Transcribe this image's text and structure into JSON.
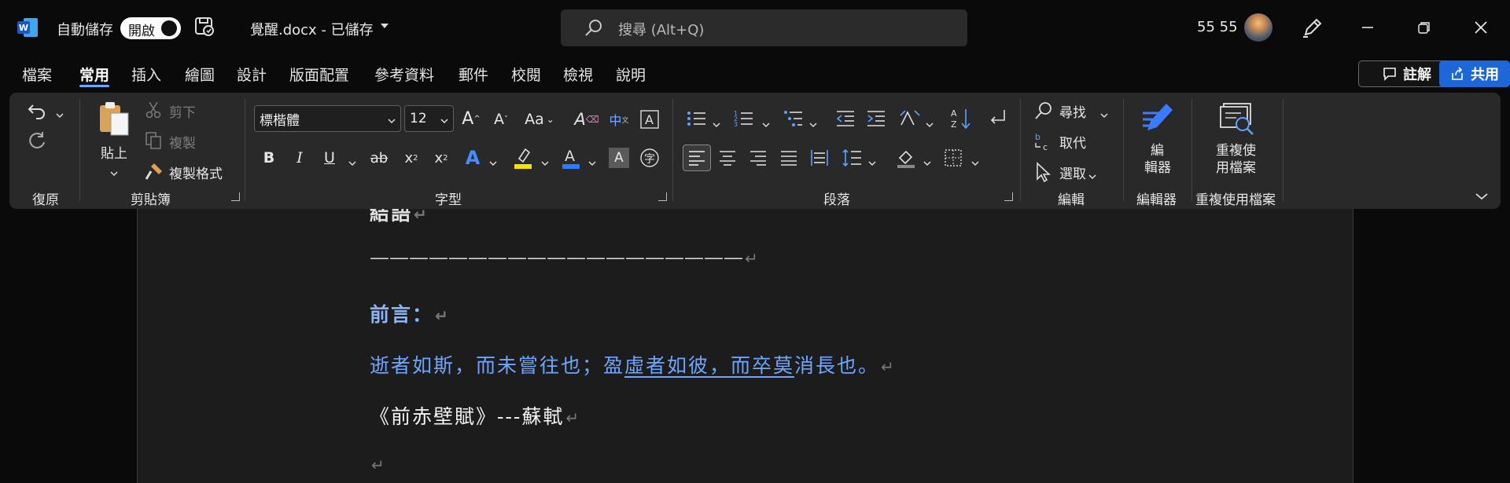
{
  "titlebar": {
    "autosave_label": "自動儲存",
    "toggle_label": "開啟",
    "doc_title": "覺醒.docx  -  已儲存",
    "search_placeholder": "搜尋 (Alt+Q)",
    "user_name": "55 55"
  },
  "tabs": [
    "檔案",
    "常用",
    "插入",
    "繪圖",
    "設計",
    "版面配置",
    "參考資料",
    "郵件",
    "校閱",
    "檢視",
    "說明"
  ],
  "active_tab": "常用",
  "actions": {
    "comments": "註解",
    "share": "共用"
  },
  "ribbon": {
    "undo_group": "復原",
    "clipboard": {
      "paste": "貼上",
      "cut": "剪下",
      "copy": "複製",
      "format_painter": "複製格式",
      "group": "剪貼簿"
    },
    "font": {
      "font_name": "標楷體",
      "font_size": "12",
      "group": "字型"
    },
    "paragraph": {
      "group": "段落"
    },
    "editing": {
      "find": "尋找",
      "replace": "取代",
      "select": "選取",
      "group": "編輯"
    },
    "editor": {
      "line1": "編",
      "line2": "輯器",
      "group": "編輯器"
    },
    "reuse": {
      "line1": "重複使",
      "line2": "用檔案",
      "group": "重複使用檔案"
    }
  },
  "document": {
    "heading_cut": "結語",
    "rule": "———————————————————",
    "heading": "前言：",
    "quote_part1": "逝者如斯，而未嘗往也；盈",
    "quote_part2": "虛者如彼，而卒莫",
    "quote_part3": "消長也。",
    "citation": "《前赤壁賦》---蘇軾",
    "para_mark": "↵"
  },
  "colors": {
    "accent": "#1e67d8",
    "heading_blue": "#8ab4f8",
    "quote_blue": "#6ea6ff",
    "ribbon_bg": "#292929"
  }
}
